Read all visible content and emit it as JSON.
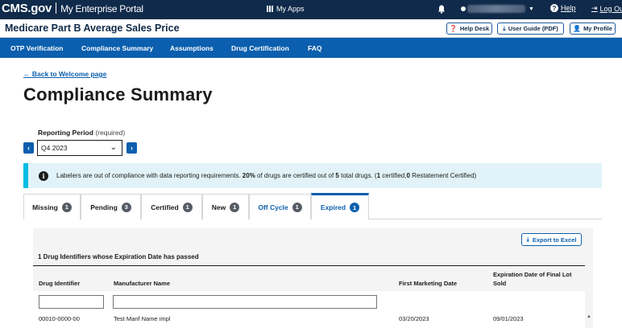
{
  "portal": {
    "logo": "CMS.gov",
    "name": "My Enterprise Portal",
    "my_apps": "My Apps",
    "help": "Help",
    "logout": "Log Out"
  },
  "header": {
    "title": "Medicare Part B Average Sales Price",
    "help_desk": "Help Desk",
    "user_guide": "User Guide (PDF)",
    "my_profile": "My Profile"
  },
  "nav": {
    "items": [
      "OTP Verification",
      "Compliance Summary",
      "Assumptions",
      "Drug Certification",
      "FAQ"
    ]
  },
  "page": {
    "back_link": "Back to Welcome page",
    "title": "Compliance Summary",
    "reporting_period_label": "Reporting Period",
    "reporting_period_required": "(required)",
    "reporting_period_value": "Q4 2023"
  },
  "alert": {
    "part1": "Labelers are out of compliance with data reporting requirements. ",
    "pct": "20%",
    "part2": " of drugs are certified out of ",
    "total": "5",
    "part3": " total drugs. (",
    "certified": "1",
    "part4": " certified,",
    "restatement": "0",
    "part5": " Restatement Certified)"
  },
  "tabs": [
    {
      "label": "Missing",
      "count": "1"
    },
    {
      "label": "Pending",
      "count": "3"
    },
    {
      "label": "Certified",
      "count": "1"
    },
    {
      "label": "New",
      "count": "1"
    },
    {
      "label": "Off Cycle",
      "count": "1"
    },
    {
      "label": "Expired",
      "count": "1"
    }
  ],
  "table": {
    "export": "Export to Excel",
    "caption": "1 Drug Identifiers whose Expiration Date has passed",
    "columns": {
      "drug_identifier": "Drug Identifier",
      "manufacturer_name": "Manufacturer Name",
      "first_marketing_date": "First Marketing Date",
      "expiration_line1": "Expiration Date of Final Lot",
      "expiration_line2": "Sold"
    },
    "rows": [
      {
        "drug_identifier": "00010-0000-00",
        "manufacturer_name": "Test Manf Name impl",
        "first_marketing_date": "03/20/2023",
        "expiration_date": "09/01/2023"
      }
    ]
  },
  "colors": {
    "portal_bar": "#0f2a4a",
    "nav_bar": "#0b5fae",
    "alert_bg": "#e1f3f8",
    "alert_border": "#00bde3"
  }
}
